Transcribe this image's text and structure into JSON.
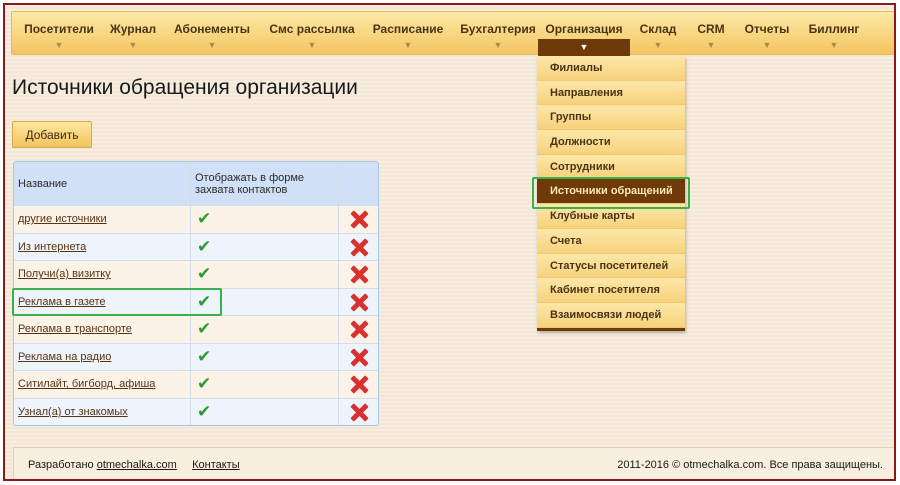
{
  "nav": {
    "items": [
      {
        "label": "Посетители"
      },
      {
        "label": "Журнал"
      },
      {
        "label": "Абонементы"
      },
      {
        "label": "Смс рассылка"
      },
      {
        "label": "Расписание"
      },
      {
        "label": "Бухгалтерия"
      },
      {
        "label": "Организация"
      },
      {
        "label": "Склад"
      },
      {
        "label": "CRM"
      },
      {
        "label": "Отчеты"
      },
      {
        "label": "Биллинг"
      }
    ],
    "arrow": "▼"
  },
  "dropdown": {
    "items": [
      {
        "label": "Филиалы"
      },
      {
        "label": "Направления"
      },
      {
        "label": "Группы"
      },
      {
        "label": "Должности"
      },
      {
        "label": "Сотрудники"
      },
      {
        "label": "Источники обращений"
      },
      {
        "label": "Клубные карты"
      },
      {
        "label": "Счета"
      },
      {
        "label": "Статусы посетителей"
      },
      {
        "label": "Кабинет посетителя"
      },
      {
        "label": "Взаимосвязи людей"
      }
    ],
    "selected_index": 5
  },
  "page": {
    "title": "Источники обращения организации",
    "add_button": "Добавить"
  },
  "table": {
    "headers": {
      "name": "Название",
      "show": "Отображать в форме захвата контактов"
    },
    "rows": [
      {
        "name": "другие источники",
        "show": true
      },
      {
        "name": "Из интернета",
        "show": true
      },
      {
        "name": "Получи(а) визитку",
        "show": true
      },
      {
        "name": "Реклама в газете",
        "show": true
      },
      {
        "name": "Реклама в транспорте",
        "show": true
      },
      {
        "name": "Реклама на радио",
        "show": true
      },
      {
        "name": "Ситилайт, бигборд, афиша",
        "show": true
      },
      {
        "name": "Узнал(а) от знакомых",
        "show": true
      }
    ],
    "check_glyph": "✔"
  },
  "footer": {
    "developed_prefix": "Разработано",
    "developer_link": "otmechalka.com",
    "contacts_link": "Контакты",
    "copyright": "2011-2016 © otmechalka.com. Все права защищены."
  },
  "colors": {
    "accent_dark": "#6e3a0a",
    "highlight_green": "#3cb04a",
    "delete_red": "#d93030",
    "check_green": "#2f9a2f"
  }
}
